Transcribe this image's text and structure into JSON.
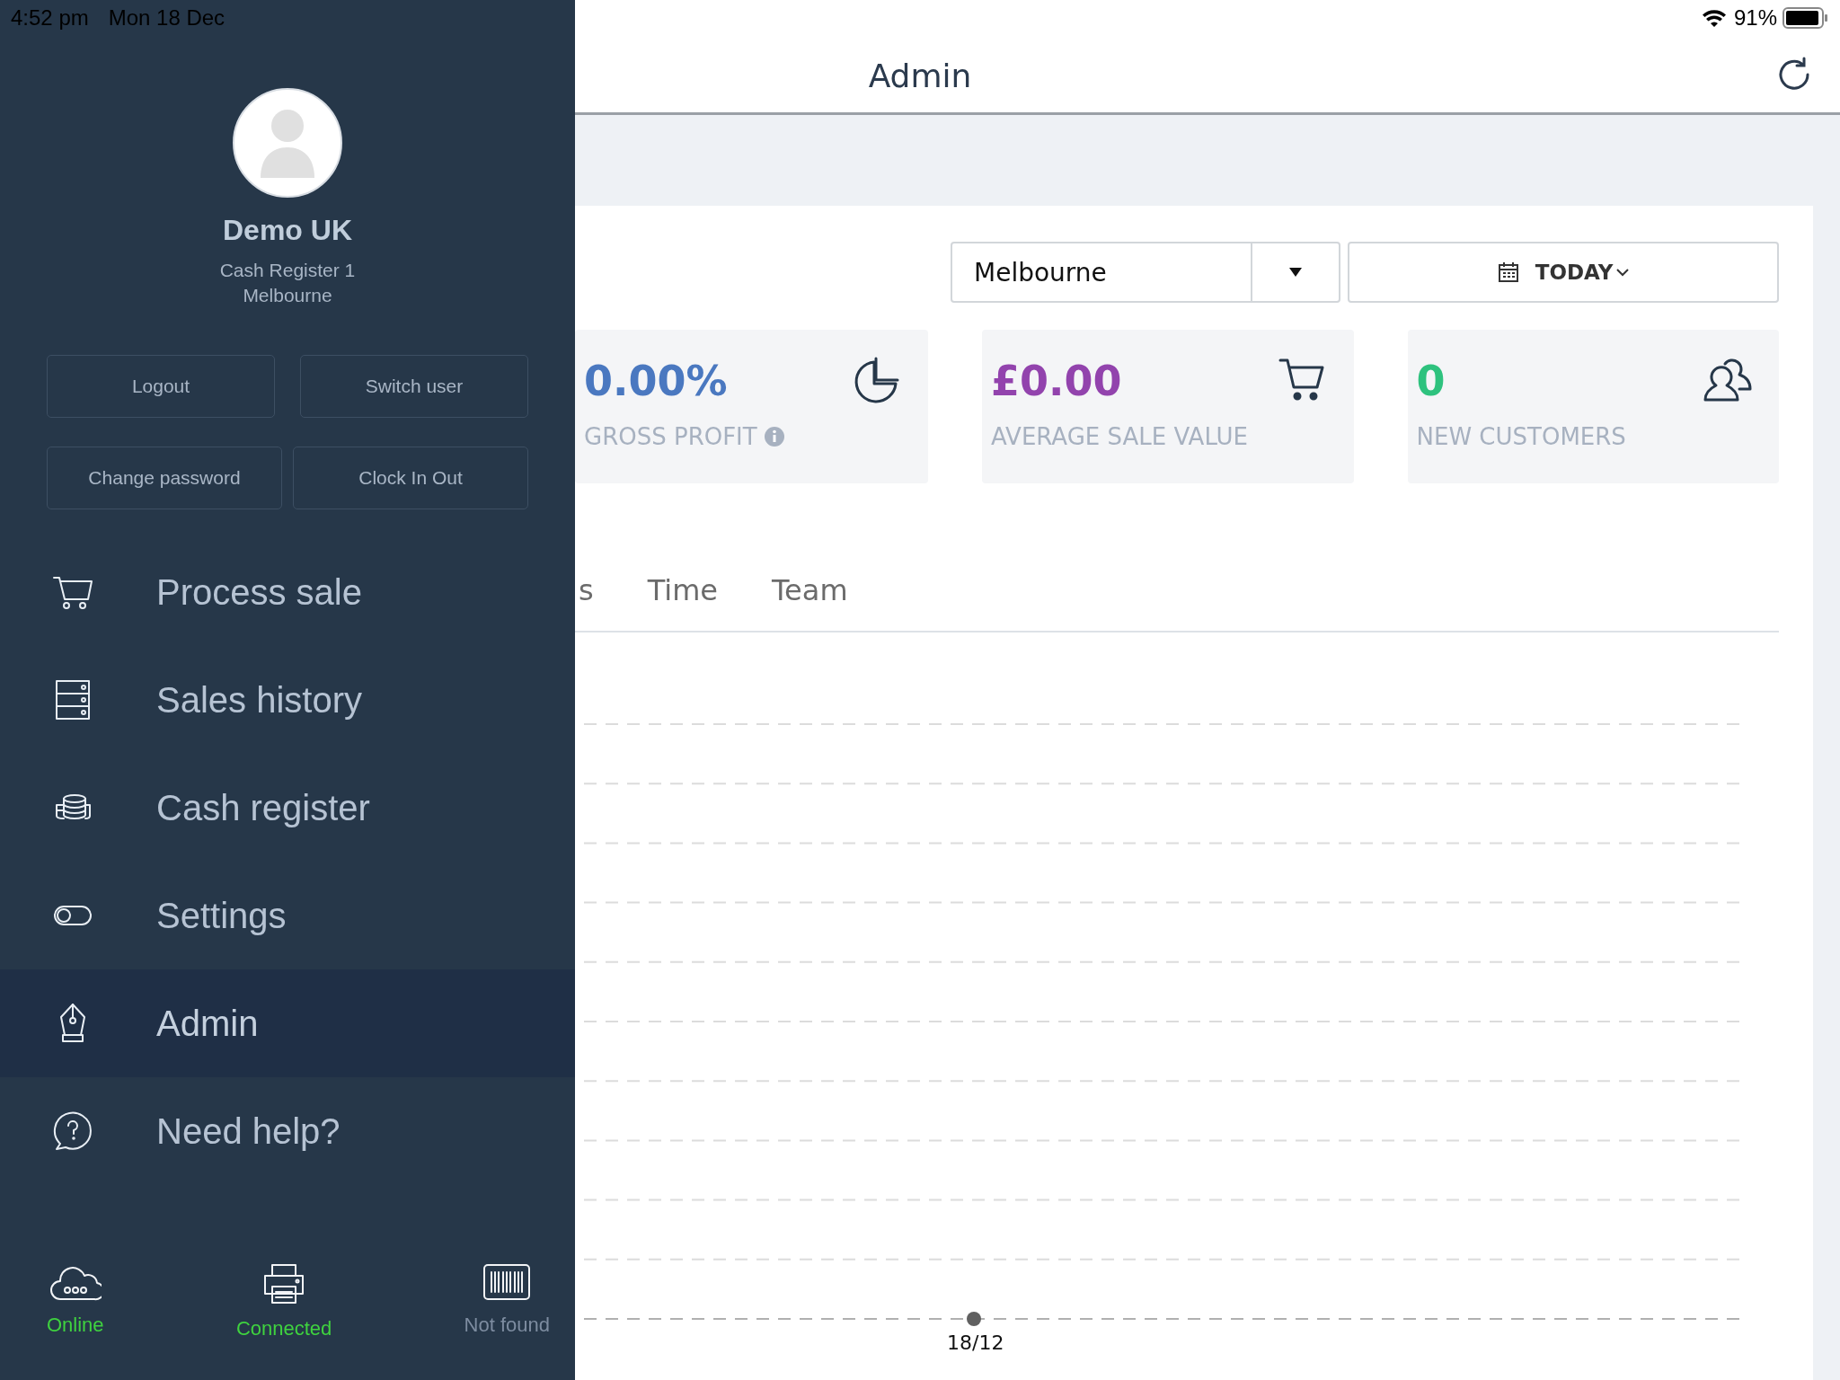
{
  "status_bar": {
    "time": "4:52 pm",
    "date": "Mon 18 Dec",
    "battery": "91%"
  },
  "sidebar": {
    "profile": {
      "name": "Demo UK",
      "register": "Cash Register 1",
      "location": "Melbourne"
    },
    "account_buttons": [
      [
        "Logout",
        "Switch user"
      ],
      [
        "Change password",
        "Clock In Out"
      ]
    ],
    "menu": [
      {
        "label": "Process sale",
        "kind": "cart",
        "selected": false
      },
      {
        "label": "Sales history",
        "kind": "drawers",
        "selected": false
      },
      {
        "label": "Cash register",
        "kind": "coins",
        "selected": false
      },
      {
        "label": "Settings",
        "kind": "toggle",
        "selected": false
      },
      {
        "label": "Admin",
        "kind": "pen",
        "selected": true
      },
      {
        "label": "Need help?",
        "kind": "help",
        "selected": false
      }
    ],
    "devices": [
      {
        "label": "Online",
        "kind": "cloud",
        "color": "#3fd23f"
      },
      {
        "label": "Connected",
        "kind": "printer",
        "color": "#3fd23f"
      },
      {
        "label": "Not found",
        "kind": "barcode",
        "color": "#7d8ca0"
      }
    ]
  },
  "header": {
    "title": "Admin"
  },
  "filters": {
    "location": "Melbourne",
    "date_range": "TODAY"
  },
  "stats": [
    {
      "value": "0.00%",
      "label": "GROSS PROFIT",
      "color": "#4a78c0",
      "kind": "pie",
      "info": true
    },
    {
      "value": "£0.00",
      "label": "AVERAGE SALE VALUE",
      "color": "#9243ad",
      "kind": "cart",
      "info": false
    },
    {
      "value": "0",
      "label": "NEW CUSTOMERS",
      "color": "#2ec27e",
      "kind": "users",
      "info": false
    }
  ],
  "tabs": [
    {
      "label": "s"
    },
    {
      "label": "Time"
    },
    {
      "label": "Team"
    }
  ],
  "chart": {
    "x_label": "18/12"
  }
}
